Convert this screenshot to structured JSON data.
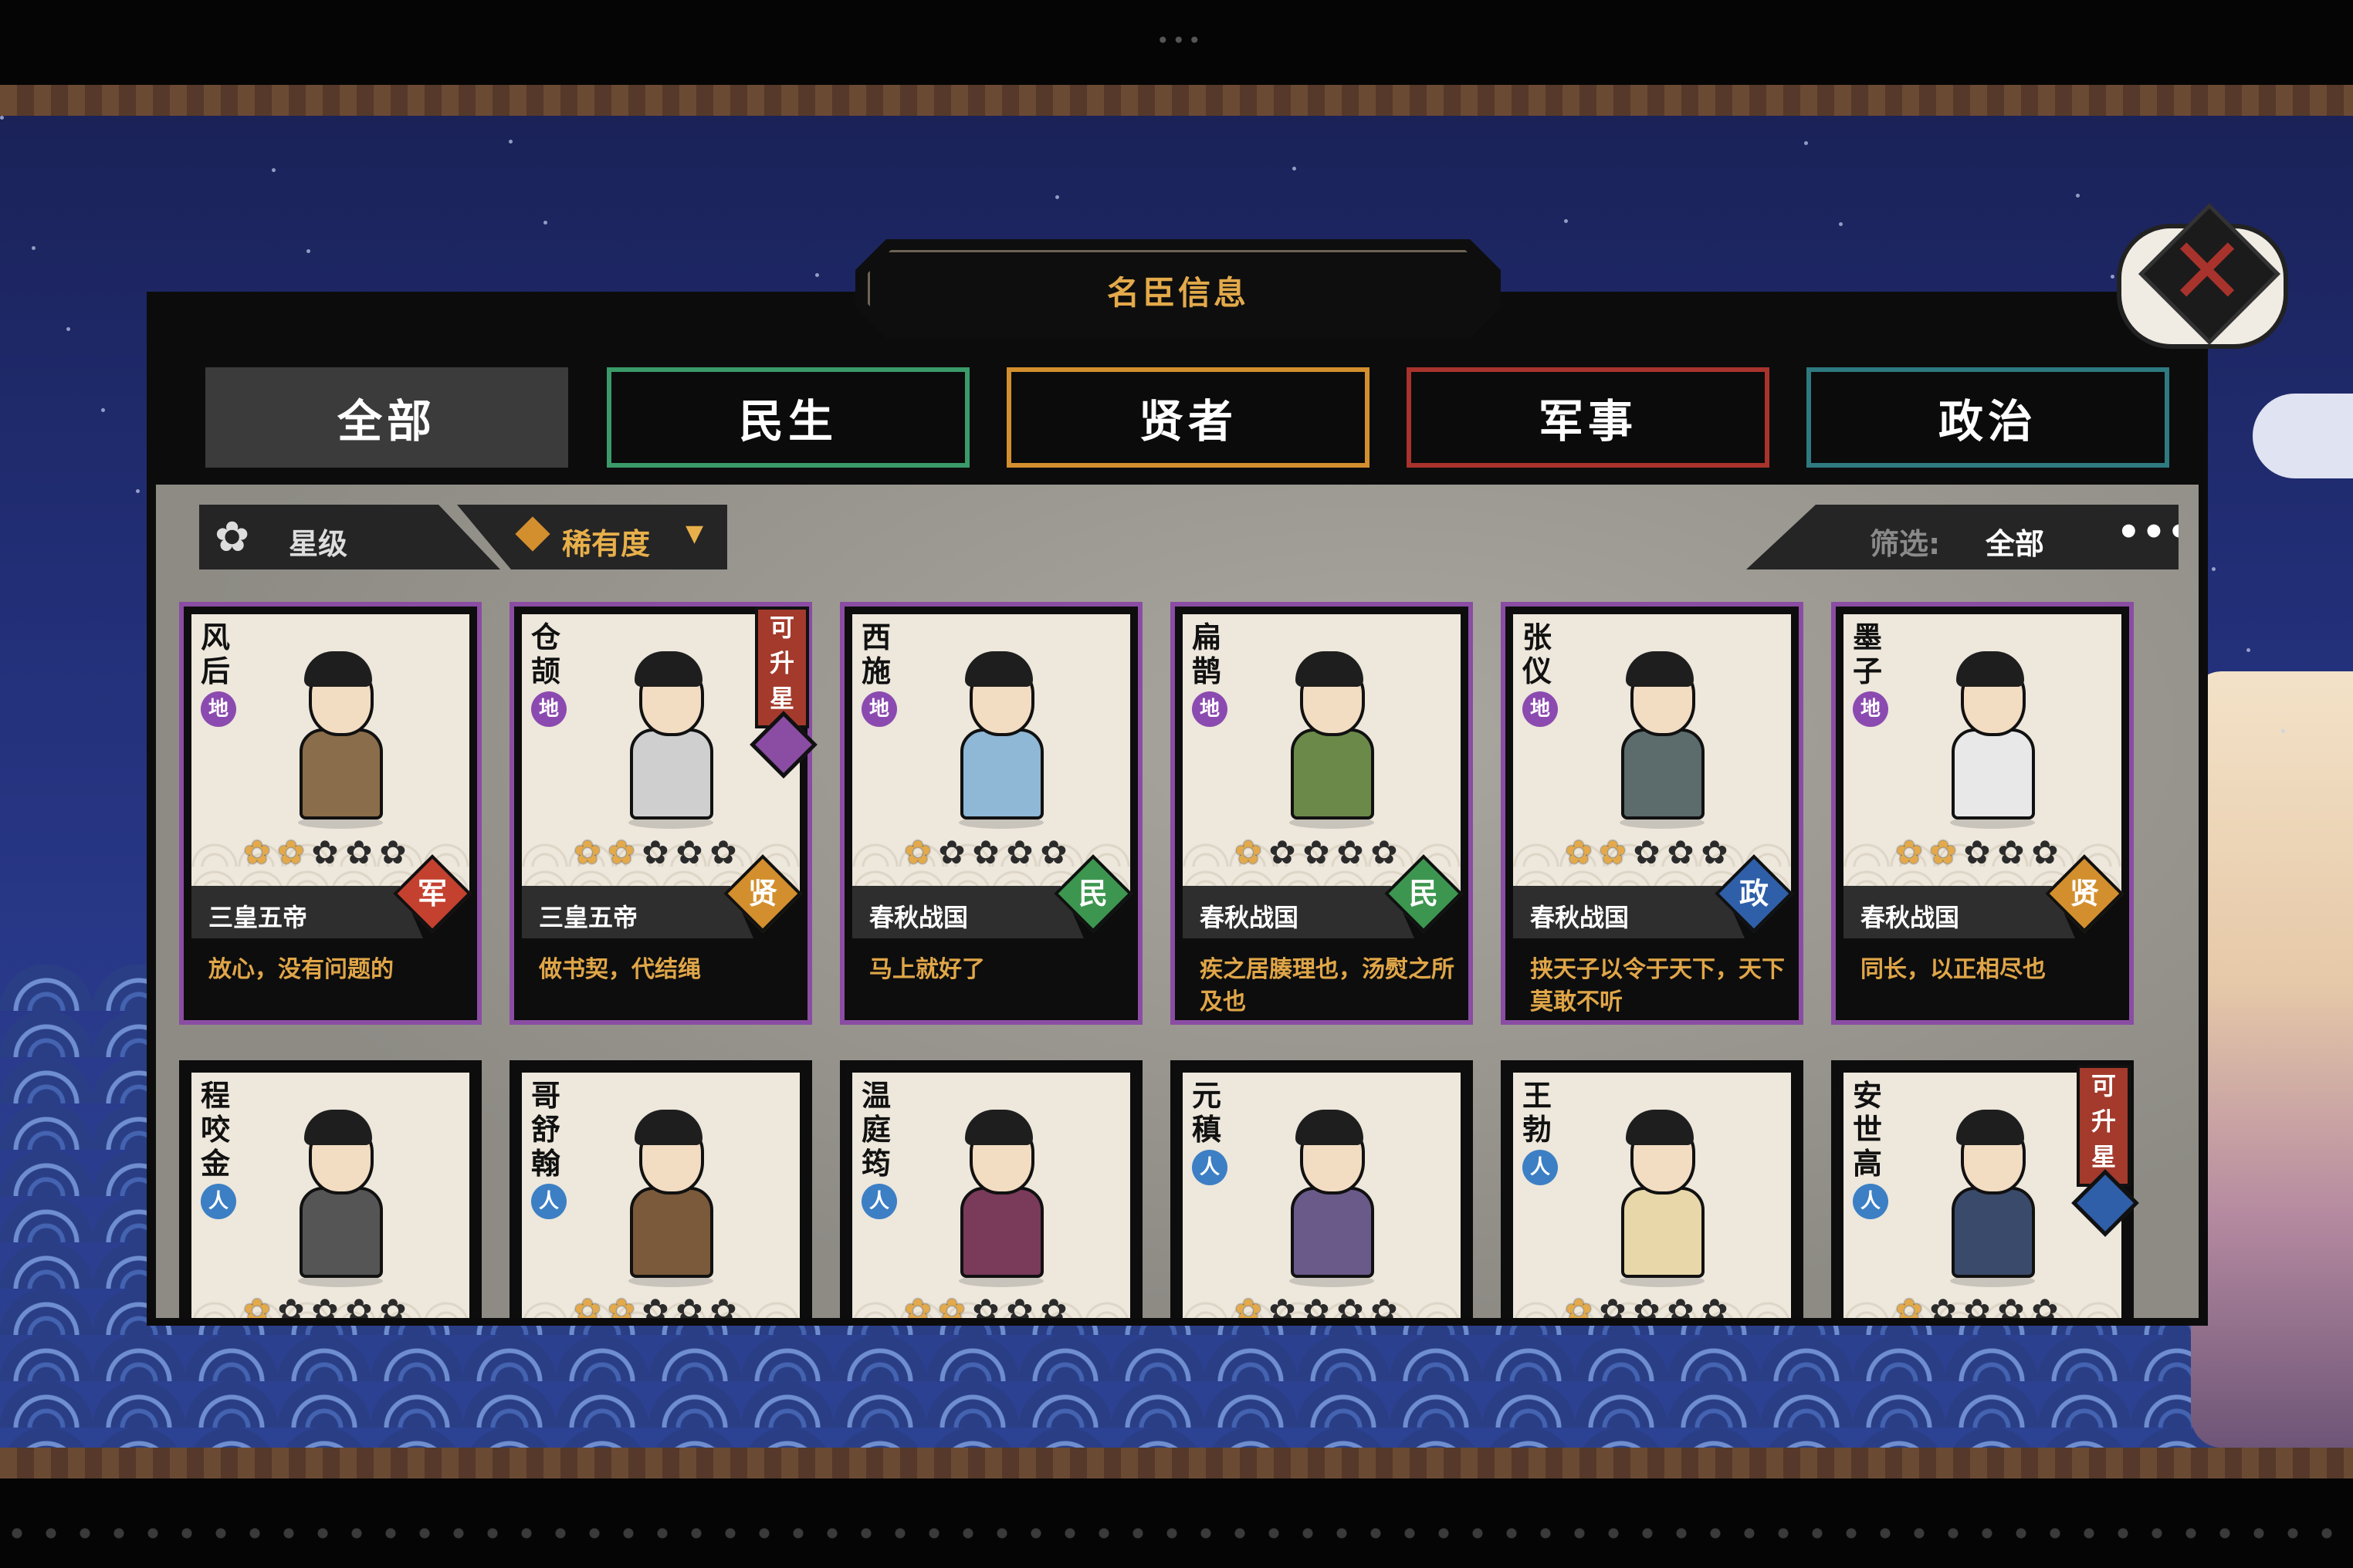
{
  "title": "名臣信息",
  "tabs": [
    {
      "label": "全部",
      "color": "#3b3b3b"
    },
    {
      "label": "民生",
      "color": "#3a9a6a"
    },
    {
      "label": "贤者",
      "color": "#d38f2e"
    },
    {
      "label": "军事",
      "color": "#a8332c"
    },
    {
      "label": "政治",
      "color": "#2e7a80"
    }
  ],
  "filters": {
    "star_label": "星级",
    "rarity_label": "稀有度",
    "filter_label": "筛选:",
    "filter_value": "全部",
    "more": "•••"
  },
  "upgrade_label": "可升星",
  "cards": [
    {
      "name": "风后",
      "realm": "地",
      "stars": 2,
      "era": "三皇五帝",
      "badge": "军",
      "quote": "放心，没有问题的",
      "upgrade": false
    },
    {
      "name": "仓颉",
      "realm": "地",
      "stars": 2,
      "era": "三皇五帝",
      "badge": "贤",
      "quote": "做书契，代结绳",
      "upgrade": true
    },
    {
      "name": "西施",
      "realm": "地",
      "stars": 1,
      "era": "春秋战国",
      "badge": "民",
      "quote": "马上就好了",
      "upgrade": false
    },
    {
      "name": "扁鹊",
      "realm": "地",
      "stars": 1,
      "era": "春秋战国",
      "badge": "民",
      "quote": "疾之居腠理也，汤熨之所及也",
      "upgrade": false
    },
    {
      "name": "张仪",
      "realm": "地",
      "stars": 2,
      "era": "春秋战国",
      "badge": "政",
      "quote": "挟天子以令于天下，天下莫敢不听",
      "upgrade": false
    },
    {
      "name": "墨子",
      "realm": "地",
      "stars": 2,
      "era": "春秋战国",
      "badge": "贤",
      "quote": "同长，以正相尽也",
      "upgrade": false
    },
    {
      "name": "程咬金",
      "realm": "人",
      "stars": 1,
      "upgrade": false
    },
    {
      "name": "哥舒翰",
      "realm": "人",
      "stars": 2,
      "upgrade": false
    },
    {
      "name": "温庭筠",
      "realm": "人",
      "stars": 2,
      "upgrade": false
    },
    {
      "name": "元稹",
      "realm": "人",
      "stars": 1,
      "upgrade": false
    },
    {
      "name": "王勃",
      "realm": "人",
      "stars": 1,
      "upgrade": false
    },
    {
      "name": "安世高",
      "realm": "人",
      "stars": 1,
      "upgrade": true
    }
  ]
}
